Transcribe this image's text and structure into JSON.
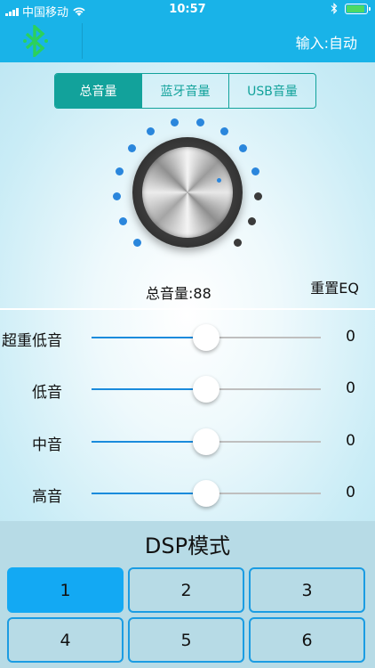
{
  "status_bar": {
    "carrier": "中国移动",
    "time": "10:57",
    "battery_level": 0.9
  },
  "nav": {
    "input_mode": "输入:自动"
  },
  "tabs": [
    {
      "label": "总音量",
      "active": true
    },
    {
      "label": "蓝牙音量",
      "active": false
    },
    {
      "label": "USB音量",
      "active": false
    }
  ],
  "knob": {
    "active_dots": 11,
    "total_dots": 14
  },
  "volume_label": "总音量:88",
  "reset_eq_label": "重置EQ",
  "eq_bands": [
    {
      "label": "超重低音",
      "value": "0",
      "position": 0.5
    },
    {
      "label": "低音",
      "value": "0",
      "position": 0.5
    },
    {
      "label": "中音",
      "value": "0",
      "position": 0.5
    },
    {
      "label": "高音",
      "value": "0",
      "position": 0.5
    }
  ],
  "dsp": {
    "title": "DSP模式",
    "modes": [
      "1",
      "2",
      "3",
      "4",
      "5",
      "6"
    ],
    "selected": "1"
  },
  "colors": {
    "header": "#19b3e8",
    "tab_accent": "#12a29b",
    "slider_fill": "#1a8bdc",
    "dot_on": "#2a86dc",
    "dot_off": "#3b3b3b",
    "dsp_active": "#13a9f3"
  }
}
